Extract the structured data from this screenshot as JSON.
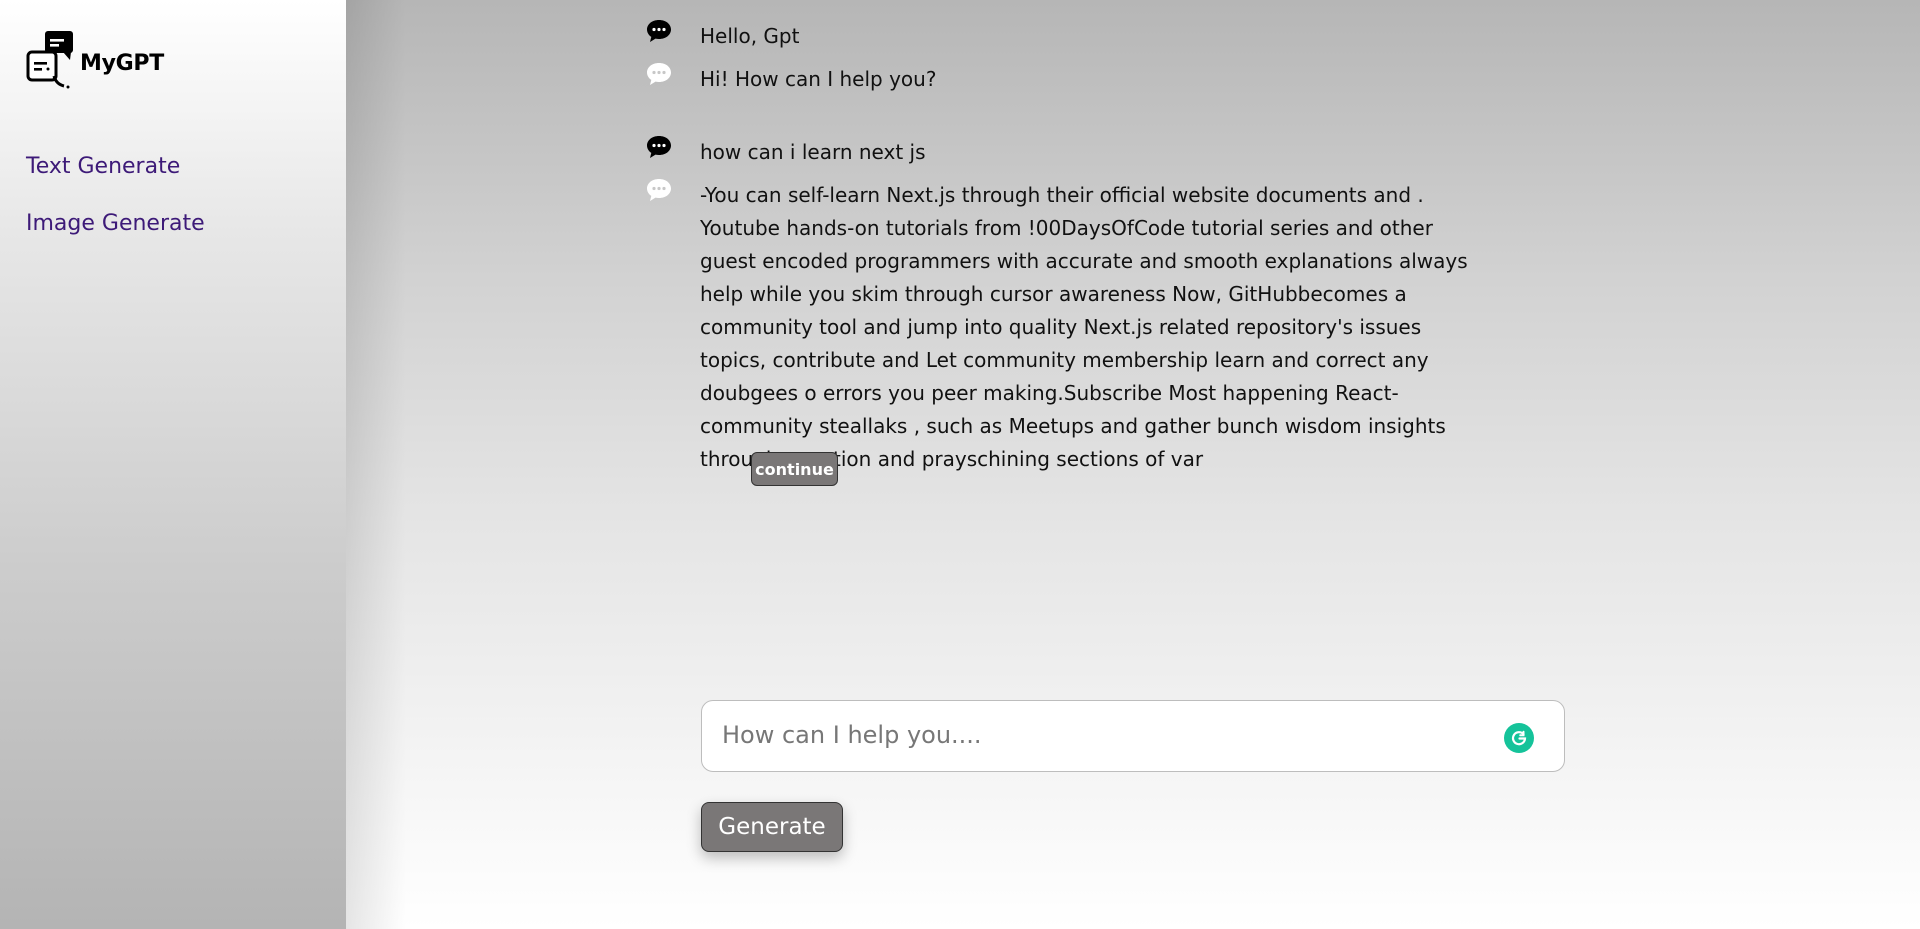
{
  "app": {
    "logo_text": "MyGPT"
  },
  "sidebar": {
    "items": [
      {
        "label": "Text Generate"
      },
      {
        "label": "Image Generate"
      }
    ]
  },
  "chat": {
    "messages": [
      {
        "role": "user",
        "icon": "chat-bubble-dark-icon",
        "text": "Hello, Gpt"
      },
      {
        "role": "assistant",
        "icon": "chat-bubble-light-icon",
        "text": "Hi! How can I help you?"
      },
      {
        "role": "user",
        "icon": "chat-bubble-dark-icon",
        "text": "how can i learn next js"
      },
      {
        "role": "assistant",
        "icon": "chat-bubble-light-icon",
        "text": "-You can self-learn Next.js through their official website documents and . Youtube hands-on tutorials from !00DaysOfCode tutorial series and other guest encoded programmers with accurate and smooth explanations always help while you skim through cursor awareness Now, GitHubbecomes a community tool and jump into quality Next.js related repository's issues topics, contribute and Let community membership learn and correct any doubgees o errors you peer making.Subscribe Most happening React-community steallaks , such as Meetups and gather bunch wisdom insights through question and prayschining sections of var"
      }
    ],
    "continue_label": "continue"
  },
  "composer": {
    "placeholder": "How can I help you....",
    "value": "",
    "generate_label": "Generate"
  },
  "colors": {
    "nav_link": "#3d1a78",
    "button_bg": "#7a7777",
    "grammarly": "#15c39a"
  }
}
